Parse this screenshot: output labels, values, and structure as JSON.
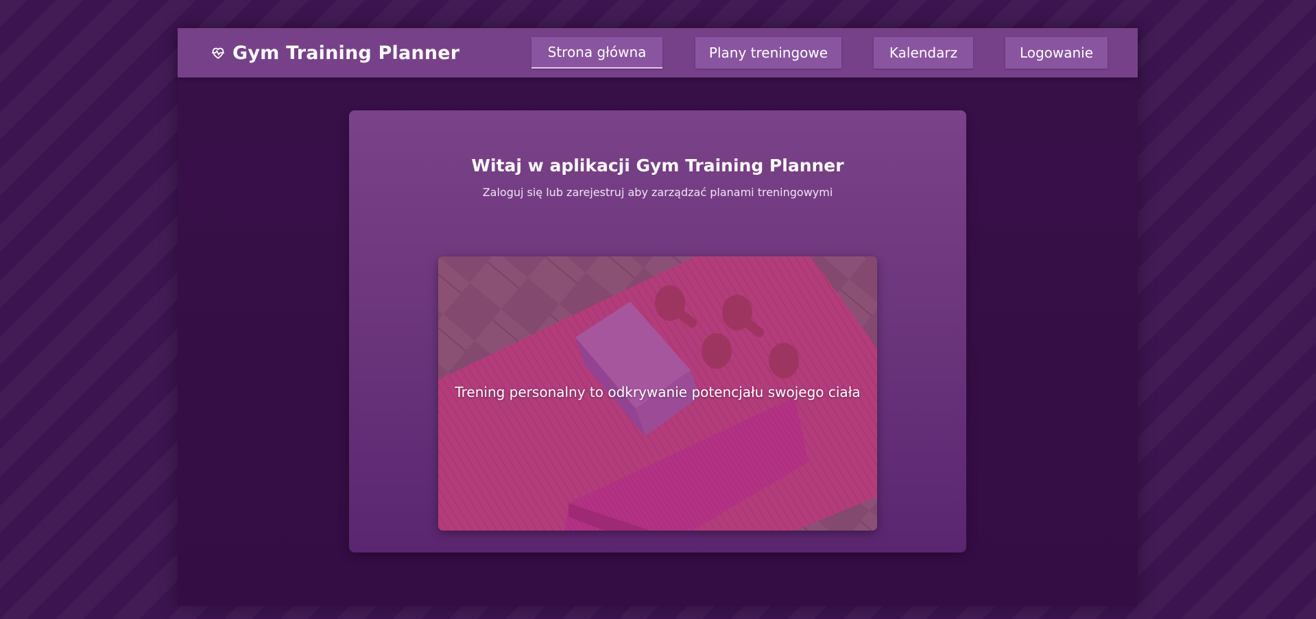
{
  "app": {
    "title": "Gym Training Planner",
    "icon": "heart-pulse-icon"
  },
  "nav": {
    "items": [
      {
        "label": "Strona główna",
        "active": true
      },
      {
        "label": "Plany treningowe",
        "active": false
      },
      {
        "label": "Kalendarz",
        "active": false
      },
      {
        "label": "Logowanie",
        "active": false
      }
    ]
  },
  "welcome": {
    "title": "Witaj w aplikacji Gym Training Planner",
    "subtitle": "Zaloguj się lub zarejestruj aby zarządzać planami treningowymi"
  },
  "hero": {
    "caption": "Trening personalny to odkrywanie potencjału swojego ciała",
    "image": "yoga-mat-dumbbells-block-towel-photo"
  },
  "colors": {
    "background": "#3c1450",
    "navbar": "#77418a",
    "nav_button": "#8a55a0",
    "card": "#70397f",
    "text": "#ffffff"
  }
}
